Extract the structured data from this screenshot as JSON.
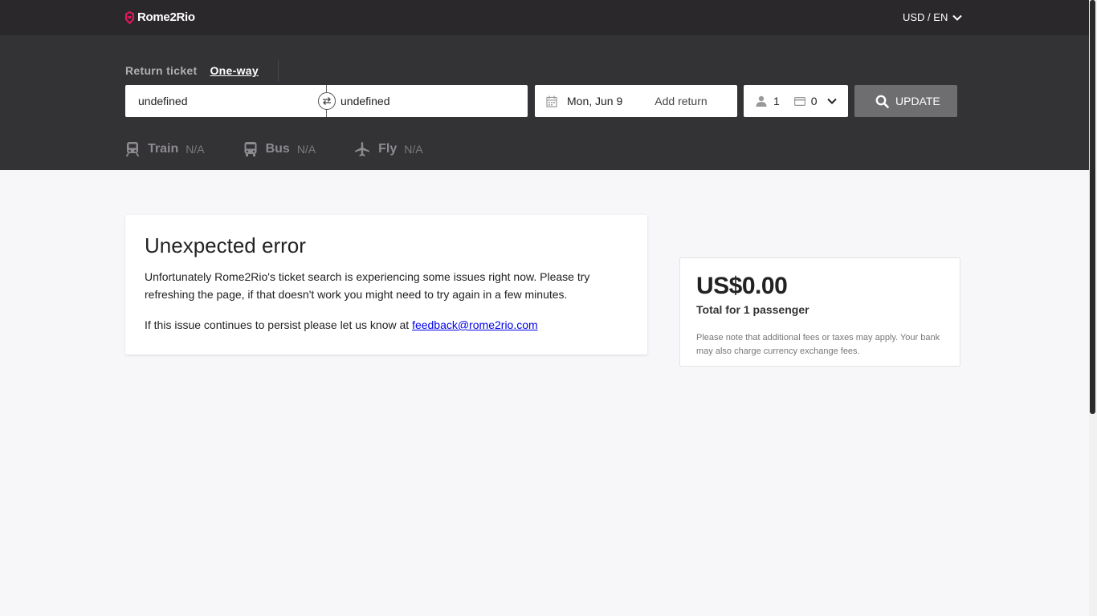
{
  "header": {
    "brand": "Rome2Rio",
    "locale": "USD / EN"
  },
  "search": {
    "return_ticket_label": "Return ticket",
    "one_way_label": "One-way",
    "origin": "undefined",
    "destination": "undefined",
    "date": "Mon, Jun 9",
    "add_return": "Add return",
    "passengers": "1",
    "discount_cards": "0",
    "update_label": "UPDATE"
  },
  "modes": [
    {
      "name": "Train",
      "value": "N/A",
      "icon": "train-icon"
    },
    {
      "name": "Bus",
      "value": "N/A",
      "icon": "bus-icon"
    },
    {
      "name": "Fly",
      "value": "N/A",
      "icon": "plane-icon"
    }
  ],
  "error": {
    "title": "Unexpected error",
    "message": "Unfortunately Rome2Rio's ticket search is experiencing some issues right now. Please try refreshing the page, if that doesn't work you might need to try again in a few minutes.",
    "persist_text": "If this issue continues to persist please let us know at ",
    "email": "feedback@rome2rio.com"
  },
  "summary": {
    "price": "US$0.00",
    "total_label": "Total for 1 passenger",
    "note": "Please note that additional fees or taxes may apply. Your bank may also charge currency exchange fees."
  },
  "colors": {
    "brand_accent": "#e8175d",
    "header_bg": "#2b282c",
    "panel_bg": "#333235",
    "update_button": "#6e6d70"
  }
}
